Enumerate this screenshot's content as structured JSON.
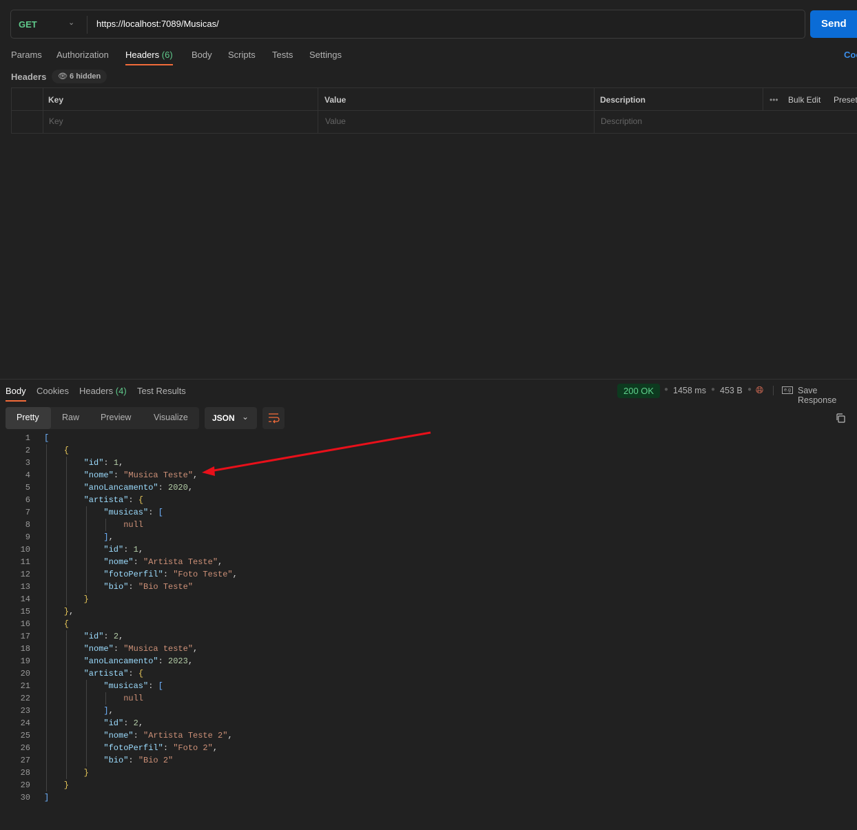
{
  "request": {
    "method": "GET",
    "url": "https://localhost:7089/Musicas/",
    "send_label": "Send",
    "cut_label": "Coo"
  },
  "request_tabs": [
    {
      "label": "Params"
    },
    {
      "label": "Authorization"
    },
    {
      "label": "Headers",
      "count": "(6)"
    },
    {
      "label": "Body"
    },
    {
      "label": "Scripts"
    },
    {
      "label": "Tests"
    },
    {
      "label": "Settings"
    }
  ],
  "headers": {
    "title": "Headers",
    "hidden": "6 hidden",
    "columns": [
      "Key",
      "Value",
      "Description"
    ],
    "placeholders": [
      "Key",
      "Value",
      "Description"
    ],
    "bulk_edit": "Bulk Edit",
    "presets": "Preset"
  },
  "response_tabs": [
    {
      "label": "Body"
    },
    {
      "label": "Cookies"
    },
    {
      "label": "Headers",
      "count": "(4)"
    },
    {
      "label": "Test Results"
    }
  ],
  "response": {
    "status": "200 OK",
    "time": "1458 ms",
    "size": "453 B",
    "save": "Save Response"
  },
  "view_modes": [
    "Pretty",
    "Raw",
    "Preview",
    "Visualize"
  ],
  "format": "JSON",
  "colors": {
    "accent": "#f26b3a",
    "send": "#0b6cd6",
    "success": "#5fd28d",
    "annotation_arrow": "#e8101a"
  },
  "code_lines": [
    {
      "i": 0,
      "t": [
        [
          "b",
          "["
        ]
      ]
    },
    {
      "i": 1,
      "t": [
        [
          "c",
          "{"
        ]
      ]
    },
    {
      "i": 2,
      "t": [
        [
          "k",
          "\"id\""
        ],
        [
          "p",
          ": "
        ],
        [
          "n",
          "1"
        ],
        [
          "p",
          ","
        ]
      ]
    },
    {
      "i": 2,
      "t": [
        [
          "k",
          "\"nome\""
        ],
        [
          "p",
          ": "
        ],
        [
          "s",
          "\"Musica Teste\""
        ],
        [
          "p",
          ","
        ]
      ]
    },
    {
      "i": 2,
      "t": [
        [
          "k",
          "\"anoLancamento\""
        ],
        [
          "p",
          ": "
        ],
        [
          "n",
          "2020"
        ],
        [
          "p",
          ","
        ]
      ]
    },
    {
      "i": 2,
      "t": [
        [
          "k",
          "\"artista\""
        ],
        [
          "p",
          ": "
        ],
        [
          "c",
          "{"
        ]
      ]
    },
    {
      "i": 3,
      "t": [
        [
          "k",
          "\"musicas\""
        ],
        [
          "p",
          ": "
        ],
        [
          "b",
          "["
        ]
      ]
    },
    {
      "i": 4,
      "t": [
        [
          "nl",
          "null"
        ]
      ]
    },
    {
      "i": 3,
      "t": [
        [
          "b",
          "]"
        ],
        [
          "p",
          ","
        ]
      ]
    },
    {
      "i": 3,
      "t": [
        [
          "k",
          "\"id\""
        ],
        [
          "p",
          ": "
        ],
        [
          "n",
          "1"
        ],
        [
          "p",
          ","
        ]
      ]
    },
    {
      "i": 3,
      "t": [
        [
          "k",
          "\"nome\""
        ],
        [
          "p",
          ": "
        ],
        [
          "s",
          "\"Artista Teste\""
        ],
        [
          "p",
          ","
        ]
      ]
    },
    {
      "i": 3,
      "t": [
        [
          "k",
          "\"fotoPerfil\""
        ],
        [
          "p",
          ": "
        ],
        [
          "s",
          "\"Foto Teste\""
        ],
        [
          "p",
          ","
        ]
      ]
    },
    {
      "i": 3,
      "t": [
        [
          "k",
          "\"bio\""
        ],
        [
          "p",
          ": "
        ],
        [
          "s",
          "\"Bio Teste\""
        ]
      ]
    },
    {
      "i": 2,
      "t": [
        [
          "c",
          "}"
        ]
      ]
    },
    {
      "i": 1,
      "t": [
        [
          "c",
          "}"
        ],
        [
          "p",
          ","
        ]
      ]
    },
    {
      "i": 1,
      "t": [
        [
          "c",
          "{"
        ]
      ]
    },
    {
      "i": 2,
      "t": [
        [
          "k",
          "\"id\""
        ],
        [
          "p",
          ": "
        ],
        [
          "n",
          "2"
        ],
        [
          "p",
          ","
        ]
      ]
    },
    {
      "i": 2,
      "t": [
        [
          "k",
          "\"nome\""
        ],
        [
          "p",
          ": "
        ],
        [
          "s",
          "\"Musica teste\""
        ],
        [
          "p",
          ","
        ]
      ]
    },
    {
      "i": 2,
      "t": [
        [
          "k",
          "\"anoLancamento\""
        ],
        [
          "p",
          ": "
        ],
        [
          "n",
          "2023"
        ],
        [
          "p",
          ","
        ]
      ]
    },
    {
      "i": 2,
      "t": [
        [
          "k",
          "\"artista\""
        ],
        [
          "p",
          ": "
        ],
        [
          "c",
          "{"
        ]
      ]
    },
    {
      "i": 3,
      "t": [
        [
          "k",
          "\"musicas\""
        ],
        [
          "p",
          ": "
        ],
        [
          "b",
          "["
        ]
      ]
    },
    {
      "i": 4,
      "t": [
        [
          "nl",
          "null"
        ]
      ]
    },
    {
      "i": 3,
      "t": [
        [
          "b",
          "]"
        ],
        [
          "p",
          ","
        ]
      ]
    },
    {
      "i": 3,
      "t": [
        [
          "k",
          "\"id\""
        ],
        [
          "p",
          ": "
        ],
        [
          "n",
          "2"
        ],
        [
          "p",
          ","
        ]
      ]
    },
    {
      "i": 3,
      "t": [
        [
          "k",
          "\"nome\""
        ],
        [
          "p",
          ": "
        ],
        [
          "s",
          "\"Artista Teste 2\""
        ],
        [
          "p",
          ","
        ]
      ]
    },
    {
      "i": 3,
      "t": [
        [
          "k",
          "\"fotoPerfil\""
        ],
        [
          "p",
          ": "
        ],
        [
          "s",
          "\"Foto 2\""
        ],
        [
          "p",
          ","
        ]
      ]
    },
    {
      "i": 3,
      "t": [
        [
          "k",
          "\"bio\""
        ],
        [
          "p",
          ": "
        ],
        [
          "s",
          "\"Bio 2\""
        ]
      ]
    },
    {
      "i": 2,
      "t": [
        [
          "c",
          "}"
        ]
      ]
    },
    {
      "i": 1,
      "t": [
        [
          "c",
          "}"
        ]
      ]
    },
    {
      "i": 0,
      "t": [
        [
          "b",
          "]"
        ]
      ]
    }
  ]
}
